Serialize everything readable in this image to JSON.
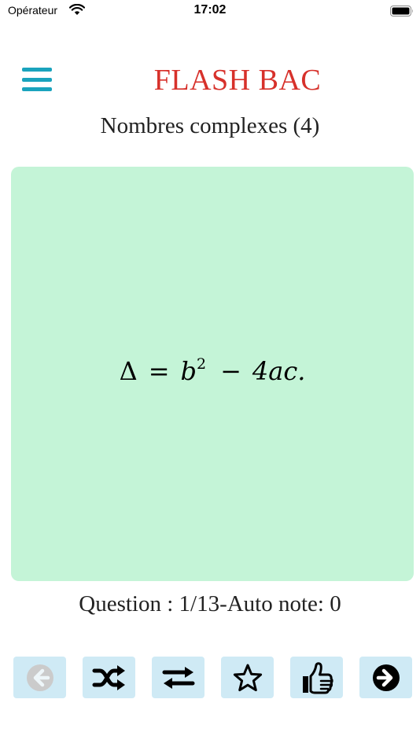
{
  "status_bar": {
    "carrier": "Opérateur",
    "time": "17:02"
  },
  "header": {
    "app_title": "FLASH BAC",
    "title_color": "#d7312b",
    "menu_icon": "hamburger-menu-icon",
    "menu_color": "#1aa3bd"
  },
  "deck": {
    "subtitle": "Nombres complexes (4)"
  },
  "card": {
    "background": "#c4f4d7",
    "formula": {
      "lhs": "Δ",
      "eq": "=",
      "b": "b",
      "exp": "2",
      "minus": "−",
      "rest": "4ac."
    }
  },
  "footer": {
    "question_text": "Question : 1/13-Auto note: 0"
  },
  "toolbar": {
    "button_background": "#cfeaf5",
    "buttons": [
      {
        "icon": "arrow-left-circle-icon",
        "disabled": true
      },
      {
        "icon": "shuffle-icon",
        "disabled": false
      },
      {
        "icon": "repeat-arrows-icon",
        "disabled": false
      },
      {
        "icon": "star-icon",
        "disabled": false
      },
      {
        "icon": "thumbs-up-icon",
        "disabled": false
      },
      {
        "icon": "arrow-right-circle-icon",
        "disabled": false
      }
    ]
  }
}
